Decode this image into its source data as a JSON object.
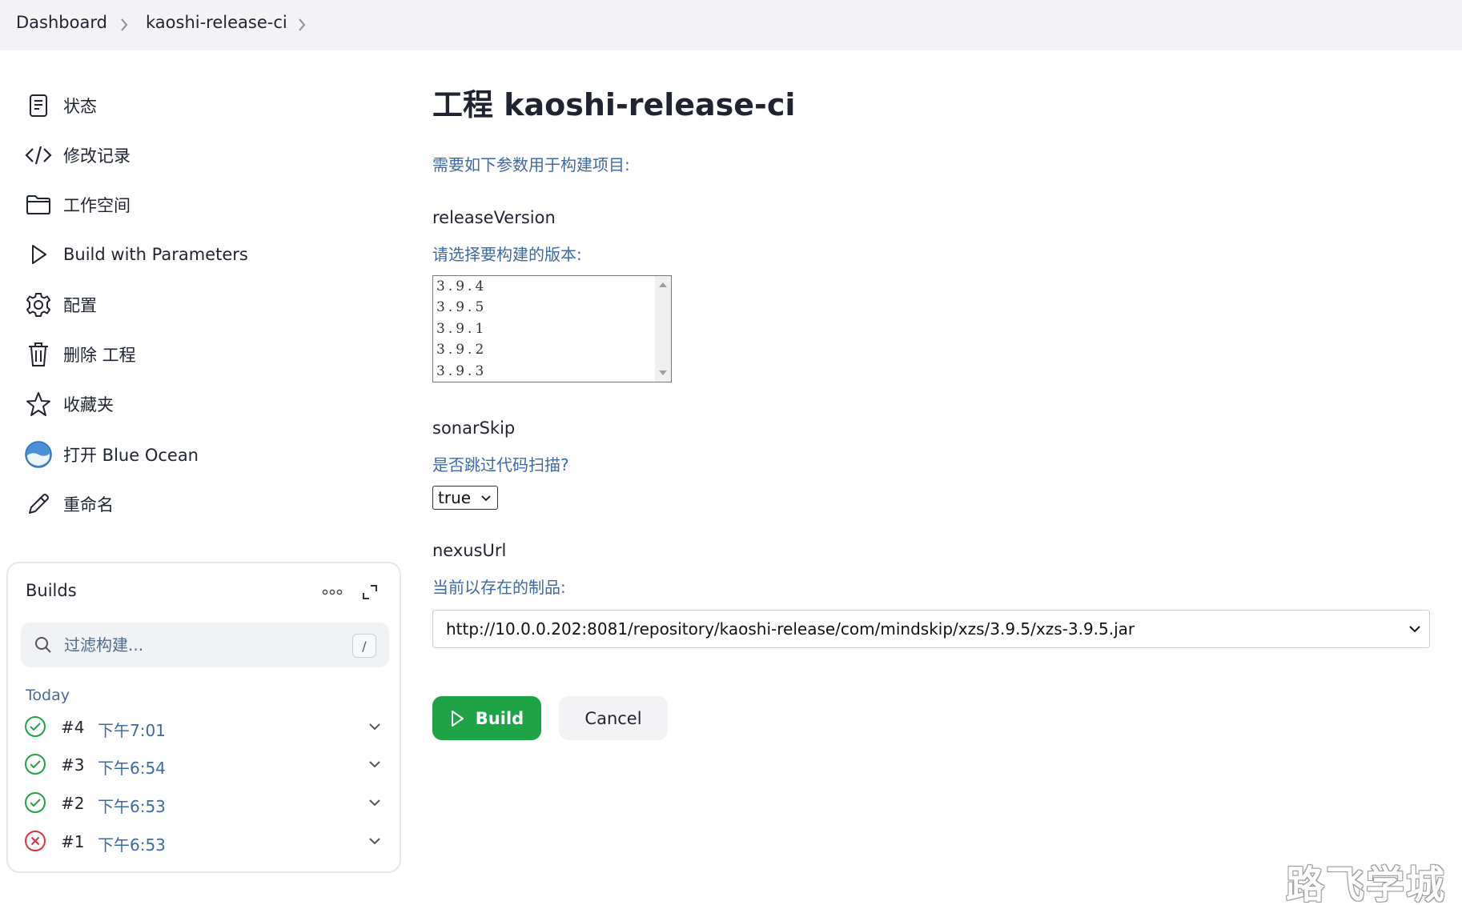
{
  "breadcrumb": {
    "items": [
      "Dashboard",
      "kaoshi-release-ci"
    ]
  },
  "sidebar": {
    "items": [
      {
        "label": "状态",
        "icon": "document-icon"
      },
      {
        "label": "修改记录",
        "icon": "code-icon"
      },
      {
        "label": "工作空间",
        "icon": "folder-icon"
      },
      {
        "label": "Build with Parameters",
        "icon": "play-icon"
      },
      {
        "label": "配置",
        "icon": "gear-icon"
      },
      {
        "label": "删除 工程",
        "icon": "trash-icon"
      },
      {
        "label": "收藏夹",
        "icon": "star-icon"
      },
      {
        "label": "打开 Blue Ocean",
        "icon": "blue-ocean-icon"
      },
      {
        "label": "重命名",
        "icon": "pencil-icon"
      }
    ]
  },
  "builds": {
    "title": "Builds",
    "filter_placeholder": "过滤构建...",
    "shortcut": "/",
    "group_label": "Today",
    "items": [
      {
        "number": "#4",
        "time": "下午7:01",
        "status": "success"
      },
      {
        "number": "#3",
        "time": "下午6:54",
        "status": "success"
      },
      {
        "number": "#2",
        "time": "下午6:53",
        "status": "success"
      },
      {
        "number": "#1",
        "time": "下午6:53",
        "status": "failed"
      }
    ]
  },
  "main": {
    "title": "工程 kaoshi-release-ci",
    "intro": "需要如下参数用于构建项目:",
    "params": {
      "release": {
        "name": "releaseVersion",
        "description": "请选择要构建的版本:",
        "options": [
          "3.9.4",
          "3.9.5",
          "3.9.1",
          "3.9.2",
          "3.9.3"
        ]
      },
      "sonar": {
        "name": "sonarSkip",
        "description": "是否跳过代码扫描?",
        "value": "true"
      },
      "nexus": {
        "name": "nexusUrl",
        "description": "当前以存在的制品:",
        "value": "http://10.0.0.202:8081/repository/kaoshi-release/com/mindskip/xzs/3.9.5/xzs-3.9.5.jar"
      }
    },
    "build_label": "Build",
    "cancel_label": "Cancel"
  },
  "watermark": "路飞学城",
  "colors": {
    "accent_link": "#3d6aa6",
    "build_button": "#1ea446",
    "success": "#1ea446",
    "failed": "#e0313a"
  }
}
